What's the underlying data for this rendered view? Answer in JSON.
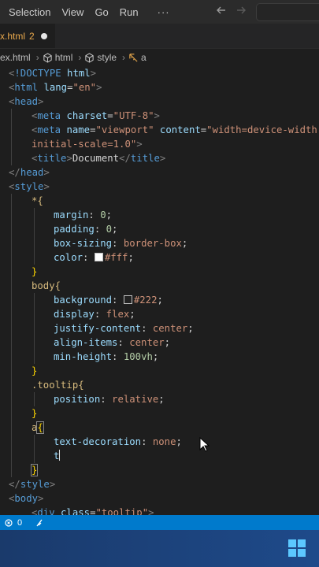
{
  "menu": {
    "items": [
      "Selection",
      "View",
      "Go",
      "Run"
    ],
    "more": "···"
  },
  "tab": {
    "filename": "x.html",
    "problems": "2"
  },
  "breadcrumb": {
    "file": "ex.html",
    "items": [
      "html",
      "style",
      "a"
    ]
  },
  "code": {
    "l1": "<!DOCTYPE html>",
    "doctype_kw": "!DOCTYPE",
    "doctype_name": "html",
    "html_tag": "html",
    "lang_attr": "lang",
    "lang_val": "\"en\"",
    "head_tag": "head",
    "meta_tag": "meta",
    "charset_attr": "charset",
    "charset_val": "\"UTF-8\"",
    "name_attr": "name",
    "name_val": "\"viewport\"",
    "content_attr": "content",
    "content_val_1": "\"width=device-width,",
    "content_val_2": "initial-scale=1.0\"",
    "title_tag": "title",
    "title_text": "Document",
    "style_tag": "style",
    "star_sel": "*{",
    "margin_prop": "margin",
    "margin_val": "0",
    "padding_prop": "padding",
    "padding_val": "0",
    "box_prop": "box-sizing",
    "box_val": "border-box",
    "color_prop": "color",
    "color_val": "#fff",
    "body_sel": "body{",
    "bg_prop": "background",
    "bg_val": "#222",
    "display_prop": "display",
    "display_val": "flex",
    "jc_prop": "justify-content",
    "jc_val": "center",
    "ai_prop": "align-items",
    "ai_val": "center",
    "mh_prop": "min-height",
    "mh_val": "100vh",
    "tooltip_sel": ".tooltip{",
    "pos_prop": "position",
    "pos_val": "relative",
    "a_sel": "a",
    "td_prop": "text-decoration",
    "td_val": "none",
    "typing": "t",
    "body_tag": "body",
    "div_tag": "div",
    "class_attr": "class",
    "class_val": "\"tooltip\""
  },
  "status": {
    "errors": "0"
  },
  "colors": {
    "accent": "#007acc",
    "swatch_fff": "#ffffff",
    "swatch_222": "#222222"
  }
}
